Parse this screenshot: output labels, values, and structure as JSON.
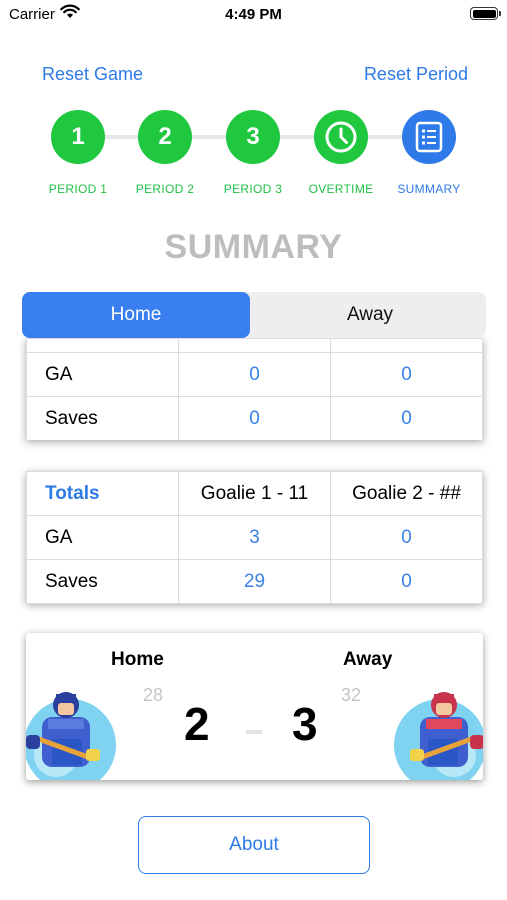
{
  "status_bar": {
    "carrier": "Carrier",
    "time": "4:49 PM"
  },
  "header": {
    "reset_game": "Reset Game",
    "reset_period": "Reset Period"
  },
  "steps": [
    {
      "number": "1",
      "label": "PERIOD 1"
    },
    {
      "number": "2",
      "label": "PERIOD 2"
    },
    {
      "number": "3",
      "label": "PERIOD 3"
    },
    {
      "icon": "clock-icon",
      "label": "OVERTIME"
    },
    {
      "icon": "list-icon",
      "label": "SUMMARY"
    }
  ],
  "title": "SUMMARY",
  "segmented": {
    "home": "Home",
    "away": "Away",
    "selected": "Home"
  },
  "period_table": {
    "rows": [
      {
        "label": "GA",
        "goalie1": "0",
        "goalie2": "0"
      },
      {
        "label": "Saves",
        "goalie1": "0",
        "goalie2": "0"
      }
    ]
  },
  "totals_table": {
    "headers": [
      "Totals",
      "Goalie 1 - 11",
      "Goalie 2 - ##"
    ],
    "rows": [
      {
        "label": "GA",
        "goalie1": "3",
        "goalie2": "0"
      },
      {
        "label": "Saves",
        "goalie1": "29",
        "goalie2": "0"
      }
    ]
  },
  "scoreboard": {
    "home_label": "Home",
    "away_label": "Away",
    "home_shots": "28",
    "away_shots": "32",
    "home_score": "2",
    "away_score": "3"
  },
  "about_button": "About",
  "colors": {
    "accent_blue": "#2d7ae8",
    "step_green": "#1fc83f",
    "title_gray": "#bdbdbd"
  }
}
